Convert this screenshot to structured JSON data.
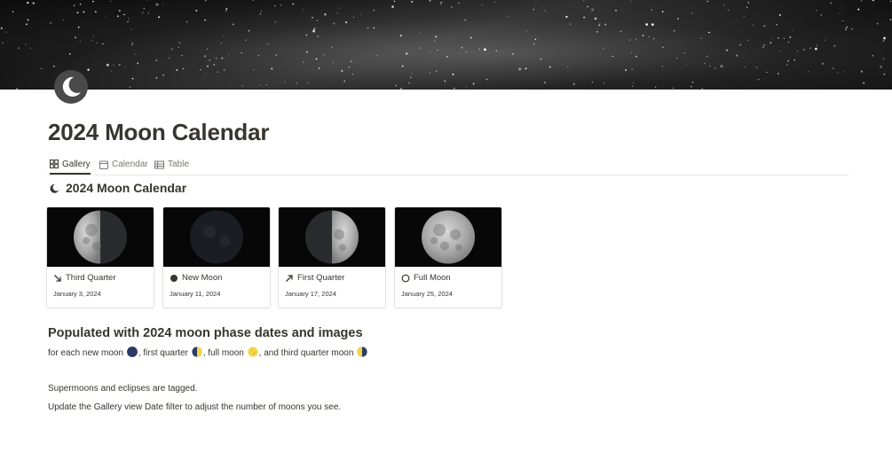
{
  "page": {
    "title": "2024 Moon Calendar",
    "icon": "crescent-moon-icon"
  },
  "tabs": [
    {
      "label": "Gallery",
      "icon": "gallery-grid-icon",
      "active": true
    },
    {
      "label": "Calendar",
      "icon": "calendar-icon",
      "active": false
    },
    {
      "label": "Table",
      "icon": "table-icon",
      "active": false
    }
  ],
  "view": {
    "title": "2024 Moon Calendar",
    "icon": "crescent-moon-icon"
  },
  "cards": [
    {
      "phase": "Third Quarter",
      "icon": "arrow-down-right-icon",
      "date": "January 3, 2024",
      "lit": "left"
    },
    {
      "phase": "New Moon",
      "icon": "filled-circle-icon",
      "date": "January 11, 2024",
      "lit": "none"
    },
    {
      "phase": "First Quarter",
      "icon": "arrow-up-right-icon",
      "date": "January 17, 2024",
      "lit": "right"
    },
    {
      "phase": "Full Moon",
      "icon": "open-circle-icon",
      "date": "January 25, 2024",
      "lit": "full"
    }
  ],
  "body": {
    "heading": "Populated with 2024 moon phase dates and images",
    "line1": {
      "p1": "for each new moon ",
      "p2": ", first quarter ",
      "p3": ", full moon ",
      "p4": ", and third quarter moon ",
      "emoji": [
        "new-moon-emoji",
        "first-quarter-moon-emoji",
        "full-moon-emoji",
        "third-quarter-moon-emoji"
      ]
    },
    "line2": "Supermoons and eclipses are tagged.",
    "line3": "Update the Gallery view Date filter to adjust the number of moons you see."
  },
  "colors": {
    "text": "#37352f",
    "muted": "#787774",
    "divider": "#e9e9e7",
    "moon_emoji_yellow": "#f5d547",
    "moon_emoji_dark": "#2c3a66"
  }
}
